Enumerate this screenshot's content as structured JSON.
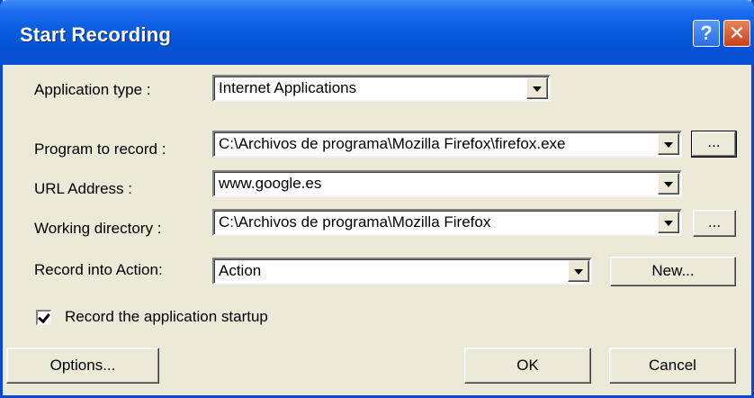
{
  "dialog": {
    "title": "Start Recording",
    "help_label": "?",
    "close_label": "✕"
  },
  "fields": {
    "application_type": {
      "label": "Application type :",
      "value": "Internet Applications"
    },
    "program_to_record": {
      "label": "Program to record :",
      "value": "C:\\Archivos de programa\\Mozilla Firefox\\firefox.exe",
      "browse_label": "..."
    },
    "url_address": {
      "label": "URL Address :",
      "value": "www.google.es"
    },
    "working_directory": {
      "label": "Working directory :",
      "value": "C:\\Archivos de programa\\Mozilla Firefox",
      "browse_label": "..."
    },
    "record_into_action": {
      "label": "Record into Action:",
      "value": "Action",
      "new_label": "New..."
    }
  },
  "record_startup": {
    "label": "Record the application startup",
    "checked": true
  },
  "buttons": {
    "options": "Options...",
    "ok": "OK",
    "cancel": "Cancel"
  }
}
